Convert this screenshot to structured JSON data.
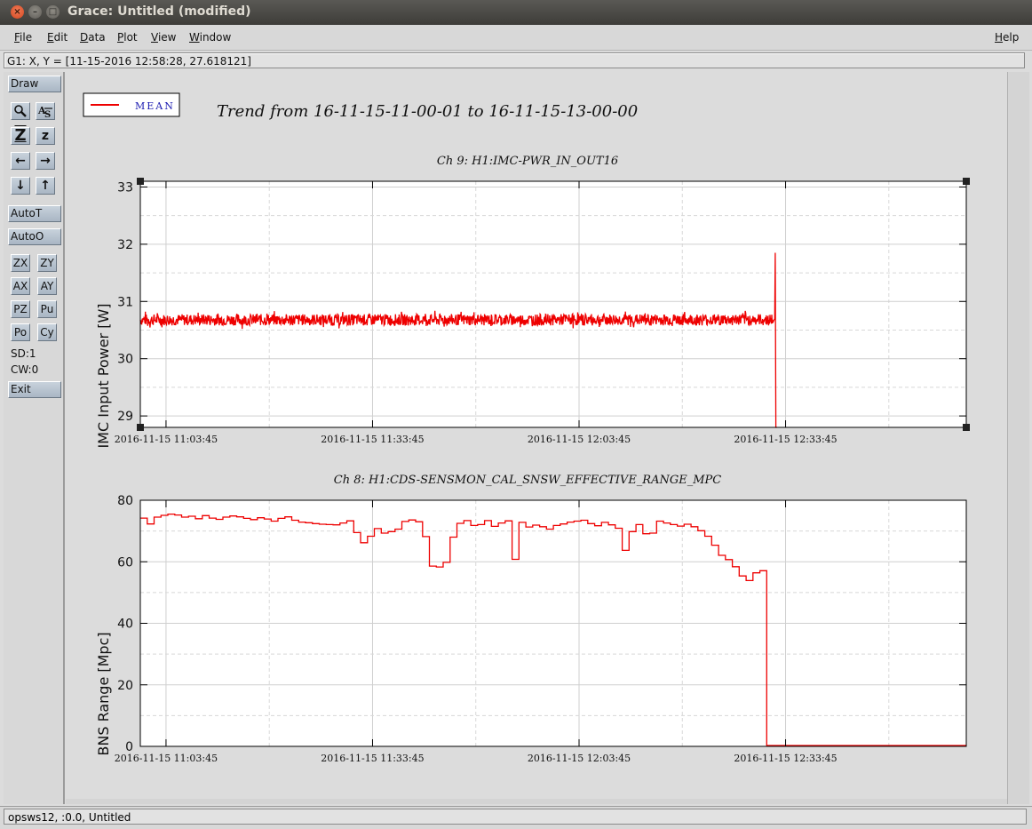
{
  "window": {
    "title": "Grace: Untitled (modified)"
  },
  "menu": {
    "file": "File",
    "edit": "Edit",
    "data": "Data",
    "plot": "Plot",
    "view": "View",
    "window": "Window",
    "help": "Help"
  },
  "locator": "G1: X, Y = [11-15-2016 12:58:28, 27.618121]",
  "toolbar": {
    "draw": "Draw",
    "zoom_icon": "magnifier-icon",
    "autoscale_icon": "autoscale-icon",
    "zoom_in": "Z",
    "zoom_out": "z",
    "left_arrow_icon": "arrow-left-icon",
    "right_arrow_icon": "arrow-right-icon",
    "down_arrow_icon": "arrow-down-icon",
    "up_arrow_icon": "arrow-up-icon",
    "autot": "AutoT",
    "autoo": "AutoO",
    "zx": "ZX",
    "zy": "ZY",
    "ax": "AX",
    "ay": "AY",
    "pz": "PZ",
    "pu": "Pu",
    "po": "Po",
    "cy": "Cy",
    "sd": "SD:1",
    "cw": "CW:0",
    "exit": "Exit"
  },
  "status": "opsws12, :0.0, Untitled",
  "colors": {
    "series": "#ee0000",
    "legend_text": "#1a1ab0"
  },
  "chart_data": [
    {
      "type": "line",
      "title": "Ch 9: H1:IMC-PWR_IN_OUT16",
      "header": "Trend from 16-11-15-11-00-01 to 16-11-15-13-00-00",
      "legend": "MEAN",
      "legend_position": "top-left",
      "ylabel": "IMC Input Power [W]",
      "xlabel": "",
      "ylim": [
        28.8,
        33.1
      ],
      "xlim": [
        "2016-11-15 11:00:01",
        "2016-11-15 13:00:00"
      ],
      "yticks": [
        29,
        30,
        31,
        32,
        33
      ],
      "xticks": [
        "2016-11-15 11:03:45",
        "2016-11-15 11:33:45",
        "2016-11-15 12:03:45",
        "2016-11-15 12:33:45"
      ],
      "grid": true,
      "series": [
        {
          "name": "MEAN",
          "x": [
            "2016-11-15 11:00:01",
            "2016-11-15 12:32:00",
            "2016-11-15 12:32:10",
            "2016-11-15 12:32:15",
            "2016-11-15 12:32:20",
            "2016-11-15 12:32:30"
          ],
          "values": [
            30.68,
            30.68,
            30.7,
            31.85,
            28.8,
            28.8
          ],
          "noise_band": 0.1
        }
      ]
    },
    {
      "type": "line",
      "title": "Ch 8: H1:CDS-SENSMON_CAL_SNSW_EFFECTIVE_RANGE_MPC",
      "ylabel": "BNS Range [Mpc]",
      "xlabel": "",
      "ylim": [
        0,
        80
      ],
      "xlim": [
        "2016-11-15 11:00:01",
        "2016-11-15 13:00:00"
      ],
      "yticks": [
        0,
        20,
        40,
        60,
        80
      ],
      "xticks": [
        "2016-11-15 11:03:45",
        "2016-11-15 11:33:45",
        "2016-11-15 12:03:45",
        "2016-11-15 12:33:45"
      ],
      "grid": true,
      "series": [
        {
          "name": "MEAN",
          "step_minutes": 1,
          "values": [
            74.2,
            72.3,
            74.5,
            75.1,
            75.5,
            75.2,
            74.5,
            74.8,
            74.0,
            75.0,
            74.2,
            73.8,
            74.5,
            74.9,
            74.6,
            74.1,
            73.7,
            74.3,
            73.9,
            73.2,
            74.1,
            74.6,
            73.5,
            72.9,
            72.7,
            72.4,
            72.2,
            72.1,
            72.0,
            72.6,
            73.3,
            69.5,
            66.2,
            68.3,
            70.8,
            69.3,
            69.8,
            70.6,
            73.1,
            73.6,
            73.0,
            68.2,
            58.6,
            58.3,
            59.8,
            68.0,
            72.5,
            73.4,
            71.8,
            72.1,
            73.4,
            71.5,
            72.6,
            73.3,
            60.8,
            72.8,
            71.3,
            71.9,
            71.4,
            70.6,
            71.8,
            72.3,
            72.9,
            73.2,
            73.5,
            72.4,
            71.7,
            72.8,
            72.0,
            70.9,
            63.7,
            69.8,
            72.1,
            69.1,
            69.3,
            73.2,
            72.6,
            72.1,
            71.6,
            72.2,
            71.4,
            70.1,
            68.3,
            65.4,
            62.1,
            60.7,
            58.4,
            55.4,
            53.9,
            56.4,
            57.1,
            0.3,
            0.3,
            0.3,
            0.3,
            0.3,
            0.3,
            0.3,
            0.3,
            0.3,
            0.3,
            0.3,
            0.3,
            0.3,
            0.3,
            0.3,
            0.3,
            0.3,
            0.3,
            0.3,
            0.3,
            0.3,
            0.3,
            0.3,
            0.3,
            0.3,
            0.3,
            0.3,
            0.3,
            0.3
          ]
        }
      ]
    }
  ]
}
